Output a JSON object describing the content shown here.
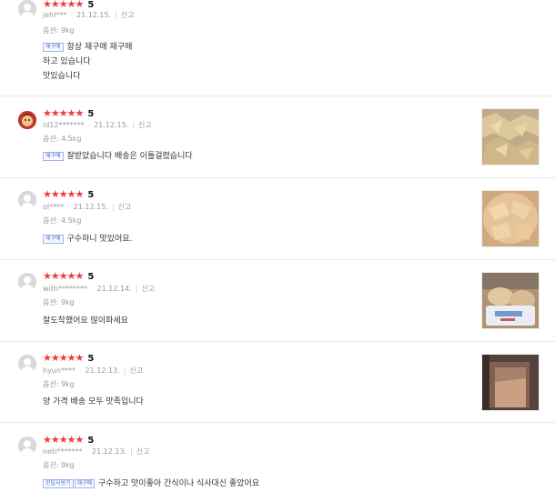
{
  "reviews": [
    {
      "rating": "5",
      "user": "jehl***",
      "date": "21.12.15.",
      "report": "신고",
      "option": "옵션: 9kg",
      "badges": [
        "재구매"
      ],
      "lines": [
        "항상 재구매 재구매",
        "하고 있습니다",
        "맛있습니다"
      ]
    },
    {
      "rating": "5",
      "user": "id12*******",
      "date": "21.12.15.",
      "report": "신고",
      "option": "옵션: 4.5kg",
      "badges": [
        "재구매"
      ],
      "lines": [
        "잘받았습니다 배송은 이틀걸렸습니다"
      ]
    },
    {
      "rating": "5",
      "user": "ol****",
      "date": "21.12.15.",
      "report": "신고",
      "option": "옵션: 4.5kg",
      "badges": [
        "재구매"
      ],
      "lines": [
        "구수하니 맛있어요."
      ]
    },
    {
      "rating": "5",
      "user": "with********",
      "date": "21.12.14.",
      "report": "신고",
      "option": "옵션: 9kg",
      "badges": [],
      "lines": [
        "잘도착했어요 많이파세요"
      ]
    },
    {
      "rating": "5",
      "user": "hyun****",
      "date": "21.12.13.",
      "report": "신고",
      "option": "옵션: 9kg",
      "badges": [],
      "lines": [
        "양 가격 배송 모두 맛족입니다"
      ]
    },
    {
      "rating": "5",
      "user": "neti*******",
      "date": "21.12.13.",
      "report": "신고",
      "option": "옵션: 9kg",
      "badges": [
        "한달사용기",
        "재구매"
      ],
      "lines": [
        "구수하고 맛이좋아 간식이나 식사대신 좋았어요"
      ]
    }
  ],
  "stars_glyph": "★★★★★",
  "colors": {
    "star": "#f2383c",
    "badge": "#4471d3",
    "divider": "#e9e9e9"
  }
}
